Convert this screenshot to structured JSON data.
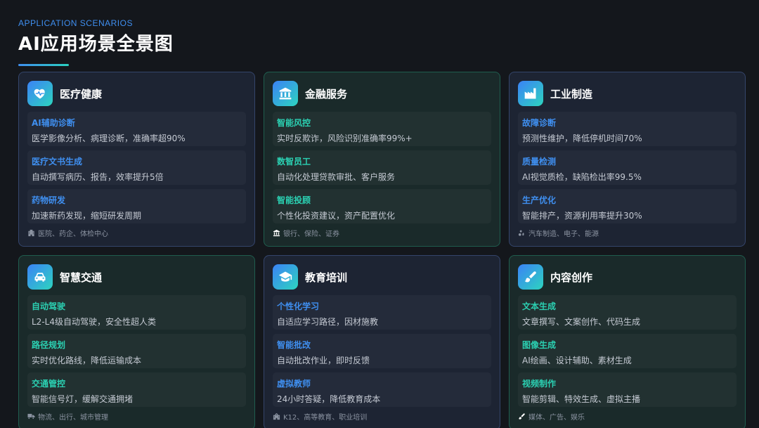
{
  "header": {
    "eyebrow": "APPLICATION SCENARIOS",
    "title": "AI应用场景全景图"
  },
  "colors": {
    "blue_accent": "#3f8ff0",
    "green_accent": "#2bd0b2",
    "background": "#14171c"
  },
  "cards": [
    {
      "theme": "blue",
      "icon": "heart-pulse-icon",
      "title": "医疗健康",
      "items": [
        {
          "title": "AI辅助诊断",
          "desc": "医学影像分析、病理诊断，准确率超90%"
        },
        {
          "title": "医疗文书生成",
          "desc": "自动撰写病历、报告，效率提升5倍"
        },
        {
          "title": "药物研发",
          "desc": "加速新药发现，缩短研发周期"
        }
      ],
      "footer_icon": "hospital-icon",
      "footer": "医院、药企、体检中心"
    },
    {
      "theme": "green",
      "icon": "bank-icon",
      "title": "金融服务",
      "items": [
        {
          "title": "智能风控",
          "desc": "实时反欺诈，风险识别准确率99%+"
        },
        {
          "title": "数智员工",
          "desc": "自动化处理贷款审批、客户服务"
        },
        {
          "title": "智能投顾",
          "desc": "个性化投资建议，资产配置优化"
        }
      ],
      "footer_icon": "bank-icon",
      "footer": "银行、保险、证券"
    },
    {
      "theme": "blue",
      "icon": "factory-icon",
      "title": "工业制造",
      "items": [
        {
          "title": "故障诊断",
          "desc": "预测性维护，降低停机时间70%"
        },
        {
          "title": "质量检测",
          "desc": "AI视觉质检，缺陷检出率99.5%"
        },
        {
          "title": "生产优化",
          "desc": "智能排产，资源利用率提升30%"
        }
      ],
      "footer_icon": "gears-icon",
      "footer": "汽车制造、电子、能源"
    },
    {
      "theme": "green",
      "icon": "car-icon",
      "title": "智慧交通",
      "items": [
        {
          "title": "自动驾驶",
          "desc": "L2-L4级自动驾驶，安全性超人类"
        },
        {
          "title": "路径规划",
          "desc": "实时优化路线，降低运输成本"
        },
        {
          "title": "交通管控",
          "desc": "智能信号灯，缓解交通拥堵"
        }
      ],
      "footer_icon": "truck-icon",
      "footer": "物流、出行、城市管理"
    },
    {
      "theme": "blue",
      "icon": "graduation-cap-icon",
      "title": "教育培训",
      "items": [
        {
          "title": "个性化学习",
          "desc": "自适应学习路径，因材施教"
        },
        {
          "title": "智能批改",
          "desc": "自动批改作业，即时反馈"
        },
        {
          "title": "虚拟教师",
          "desc": "24小时答疑，降低教育成本"
        }
      ],
      "footer_icon": "school-icon",
      "footer": "K12、高等教育、职业培训"
    },
    {
      "theme": "green",
      "icon": "paintbrush-icon",
      "title": "内容创作",
      "items": [
        {
          "title": "文本生成",
          "desc": "文章撰写、文案创作、代码生成"
        },
        {
          "title": "图像生成",
          "desc": "AI绘画、设计辅助、素材生成"
        },
        {
          "title": "视频制作",
          "desc": "智能剪辑、特效生成、虚拟主播"
        }
      ],
      "footer_icon": "paintbrush-icon",
      "footer": "媒体、广告、娱乐"
    }
  ]
}
